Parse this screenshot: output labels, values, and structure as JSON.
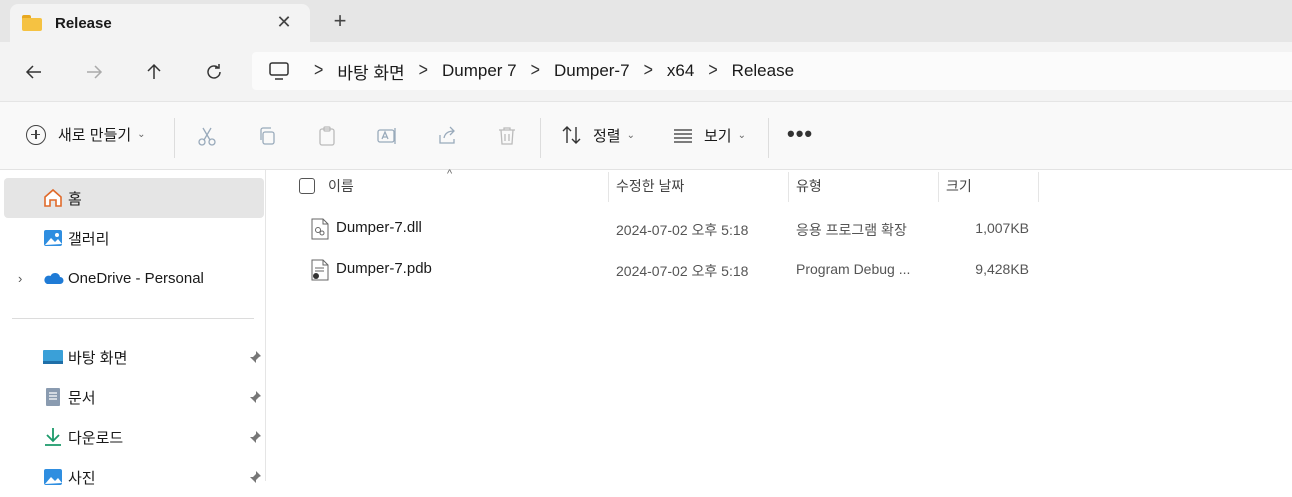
{
  "window": {
    "tab_title": "Release",
    "close_symbol": "✕",
    "new_tab_symbol": "+"
  },
  "address_bar": {
    "separator": ">",
    "breadcrumbs": [
      "바탕 화면",
      "Dumper 7",
      "Dumper-7",
      "x64",
      "Release"
    ]
  },
  "toolbar": {
    "new_label": "새로 만들기",
    "sort_label": "정렬",
    "view_label": "보기",
    "more_label": "•••",
    "chevron": "⌄"
  },
  "sidebar": {
    "items": [
      {
        "label": "홈",
        "icon": "home-icon"
      },
      {
        "label": "갤러리",
        "icon": "gallery-icon"
      },
      {
        "label": "OneDrive - Personal",
        "icon": "onedrive-icon"
      },
      {
        "label": "바탕 화면",
        "icon": "desktop-icon"
      },
      {
        "label": "문서",
        "icon": "documents-icon"
      },
      {
        "label": "다운로드",
        "icon": "downloads-icon"
      },
      {
        "label": "사진",
        "icon": "pictures-icon"
      }
    ],
    "expander": "›"
  },
  "columns": {
    "name": "이름",
    "modified": "수정한 날짜",
    "type": "유형",
    "size": "크기",
    "sort_indicator": "^"
  },
  "files": [
    {
      "name": "Dumper-7.dll",
      "modified": "2024-07-02 오후 5:18",
      "type": "응용 프로그램 확장",
      "size": "1,007KB",
      "icon": "dll-file-icon"
    },
    {
      "name": "Dumper-7.pdb",
      "modified": "2024-07-02 오후 5:18",
      "type": "Program Debug ...",
      "size": "9,428KB",
      "icon": "pdb-file-icon"
    }
  ],
  "colors": {
    "folder": "#f5c242",
    "accent": "#0067c0",
    "selected": "#e5e5e5"
  }
}
